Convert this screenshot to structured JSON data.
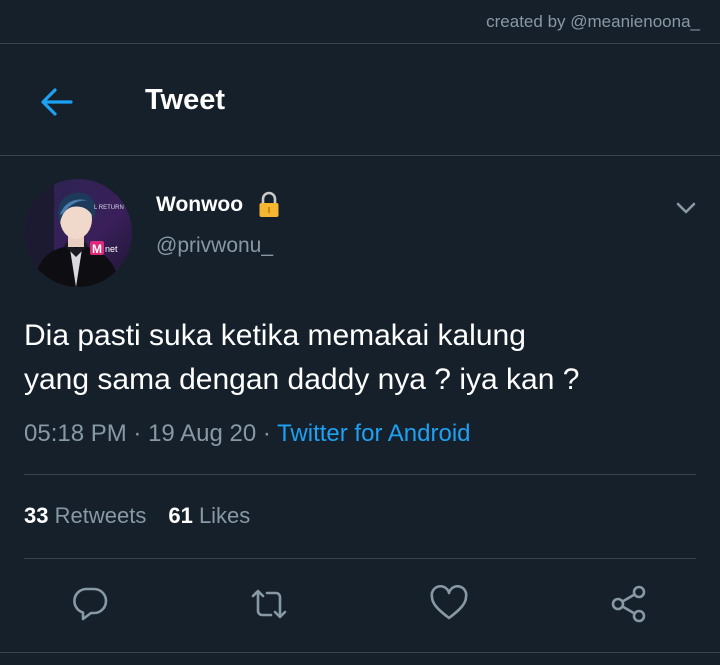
{
  "watermark": "created by @meanienoona_",
  "header": {
    "title": "Tweet",
    "back_icon": "arrow-left-icon"
  },
  "tweet": {
    "display_name": "Wonwoo",
    "handle": "@privwonu_",
    "avatar_text_top": "L RETURN",
    "avatar_text_logo": "M",
    "avatar_text_net": "net",
    "lines": [
      "Dia pasti suka ketika memakai kalung",
      "yang sama dengan daddy nya ? iya kan ?"
    ],
    "time": "05:18 PM",
    "date": "19 Aug 20",
    "separator": " · ",
    "source": "Twitter for Android",
    "retweets_count": "33",
    "retweets_label": "Retweets",
    "likes_count": "61",
    "likes_label": "Likes"
  },
  "colors": {
    "background": "#15202b",
    "divider": "#38444d",
    "secondary_text": "#8899a6",
    "accent": "#1da1f2",
    "lock": "#f5b731"
  }
}
